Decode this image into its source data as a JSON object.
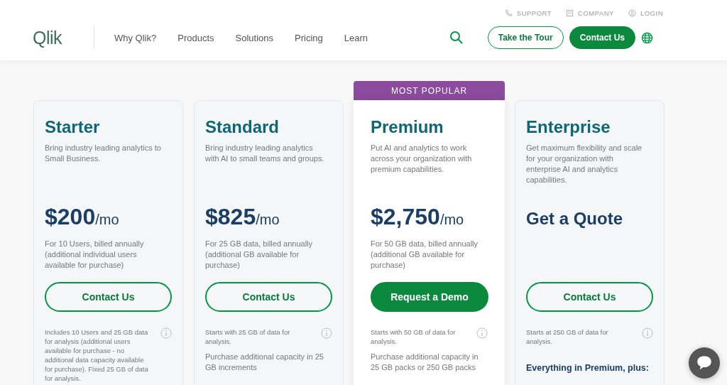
{
  "header": {
    "utility_links": [
      {
        "label": "SUPPORT",
        "kind": "phone"
      },
      {
        "label": "COMPANY",
        "kind": "building"
      },
      {
        "label": "LOGIN",
        "kind": "user"
      }
    ],
    "logo": "Qlik",
    "nav": [
      {
        "label": "Why Qlik?"
      },
      {
        "label": "Products"
      },
      {
        "label": "Solutions"
      },
      {
        "label": "Pricing"
      },
      {
        "label": "Learn"
      }
    ],
    "buttons": [
      {
        "label": "Take the Tour",
        "primary": false
      },
      {
        "label": "Contact Us",
        "primary": true
      }
    ]
  },
  "plans": [
    {
      "name": "Starter",
      "featured": false,
      "description": "Bring industry leading analytics to Small Business.",
      "kind": "price",
      "price": "$200",
      "period": "/mo",
      "billing": "For 10 Users, billed annually (additional individual users available for purchase)",
      "cta": {
        "label": "Contact Us",
        "primary": false
      },
      "footnote": "Includes 10 Users and 25 GB data for analysis (additional users available for purchase - no additional data capacity available for purchase). Fixed 25 GB of data for analysis."
    },
    {
      "name": "Standard",
      "featured": false,
      "description": "Bring industry leading analytics with AI to small teams and groups.",
      "kind": "price",
      "price": "$825",
      "period": "/mo",
      "billing": "For 25 GB data, billed annually (additional GB available for purchase)",
      "cta": {
        "label": "Contact Us",
        "primary": false
      },
      "footnote": "Starts with 25 GB of data for analysis.",
      "extra": "Purchase additional capacity in 25 GB increments"
    },
    {
      "name": "Premium",
      "featured": true,
      "badge": "MOST POPULAR",
      "description": "Put AI and analytics to work across your organization with premium capabilities.",
      "kind": "price",
      "price": "$2,750",
      "period": "/mo",
      "billing": "For 50 GB data, billed annually (additional GB available for purchase)",
      "cta": {
        "label": "Request a Demo",
        "primary": true
      },
      "footnote": "Starts with 50 GB of data for analysis.",
      "extra": "Purchase additional capacity in 25 GB packs or 250 GB packs"
    },
    {
      "name": "Enterprise",
      "featured": false,
      "description": "Get maximum flexibility and scale for your organization with enterprise AI and analytics capabilities.",
      "kind": "quote",
      "price": "Get a Quote",
      "cta": {
        "label": "Contact Us",
        "primary": false
      },
      "footnote": "Starts at 250 GB of data for analysis.",
      "includes": "Everything in Premium, plus:"
    }
  ]
}
